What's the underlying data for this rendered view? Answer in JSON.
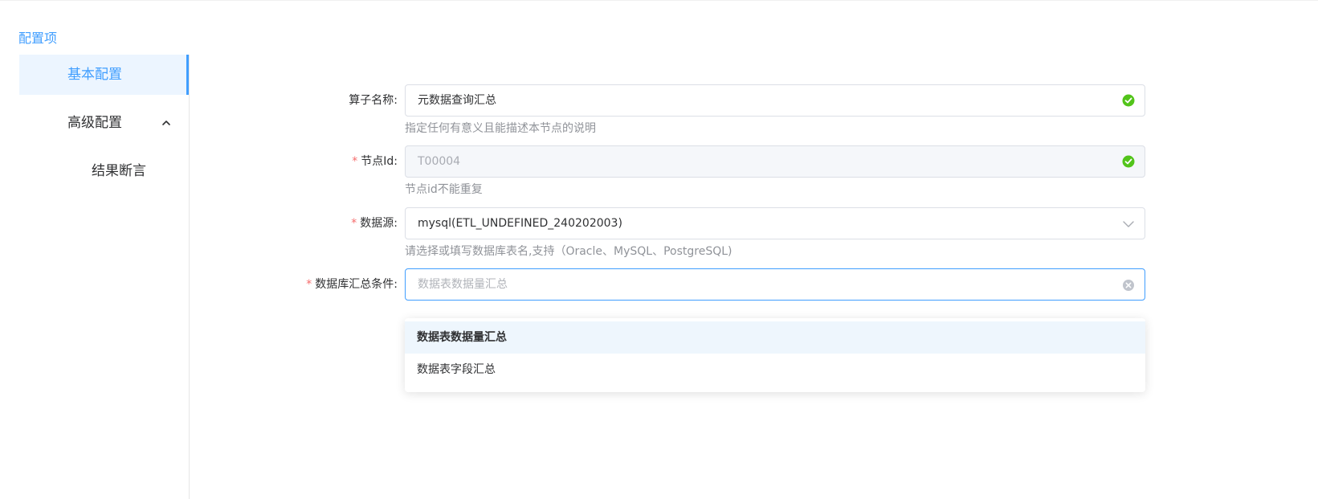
{
  "sidebar": {
    "title": "配置项",
    "items": [
      {
        "label": "基本配置",
        "active": true
      },
      {
        "label": "高级配置",
        "expanded": true
      },
      {
        "label": "结果断言"
      }
    ]
  },
  "form": {
    "operator_name": {
      "label": "算子名称:",
      "value": "元数据查询汇总",
      "helper": "指定任何有意义且能描述本节点的说明",
      "required": false
    },
    "node_id": {
      "label": "节点Id:",
      "value": "T00004",
      "helper": "节点id不能重复",
      "required": true
    },
    "datasource": {
      "label": "数据源:",
      "value": "mysql(ETL_UNDEFINED_240202003)",
      "helper": "请选择或填写数据库表名,支持（Oracle、MySQL、PostgreSQL)",
      "required": true
    },
    "summary_condition": {
      "label": "数据库汇总条件:",
      "placeholder": "数据表数据量汇总",
      "required": true
    }
  },
  "dropdown": {
    "options": [
      {
        "label": "数据表数据量汇总",
        "selected": true
      },
      {
        "label": "数据表字段汇总",
        "selected": false
      }
    ]
  },
  "colors": {
    "accent": "#409eff",
    "success": "#67c23a",
    "required": "#f56c6c"
  },
  "icons": {
    "valid": "check-circle-icon",
    "dropdown": "chevron-down-icon",
    "clear": "clear-circle-icon",
    "collapse": "chevron-up-icon"
  }
}
